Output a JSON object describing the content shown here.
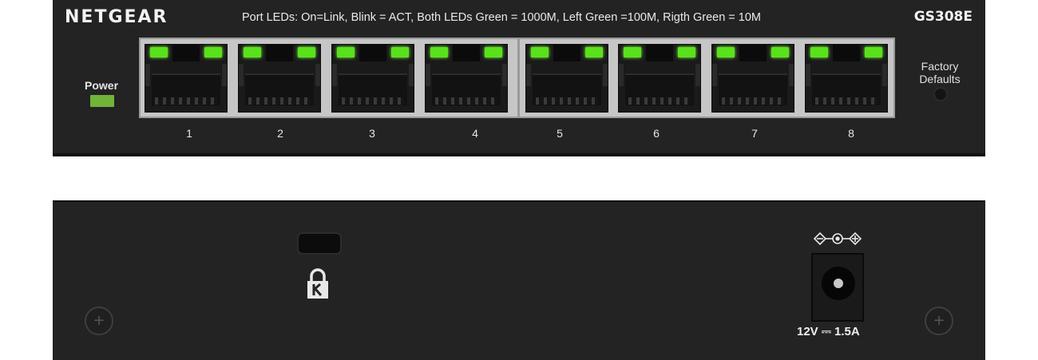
{
  "front_panel": {
    "brand": "NETGEAR",
    "led_legend": "Port LEDs: On=Link, Blink = ACT, Both LEDs Green = 1000M, Left Green =100M, Rigth Green = 10M",
    "model": "GS308E",
    "power_label": "Power",
    "factory_label_line1": "Factory",
    "factory_label_line2": "Defaults",
    "ports": [
      "1",
      "2",
      "3",
      "4",
      "5",
      "6",
      "7",
      "8"
    ],
    "colors": {
      "chassis": "#232323",
      "port_led": "#59e21c",
      "power_led": "#72b43a"
    }
  },
  "rear_panel": {
    "power_rating": "12V ⎓ 1.5A",
    "icons": [
      "kensington-slot",
      "kensington-lock-icon",
      "dc-polarity-icon",
      "dc-power-jack",
      "screw-icon"
    ]
  }
}
